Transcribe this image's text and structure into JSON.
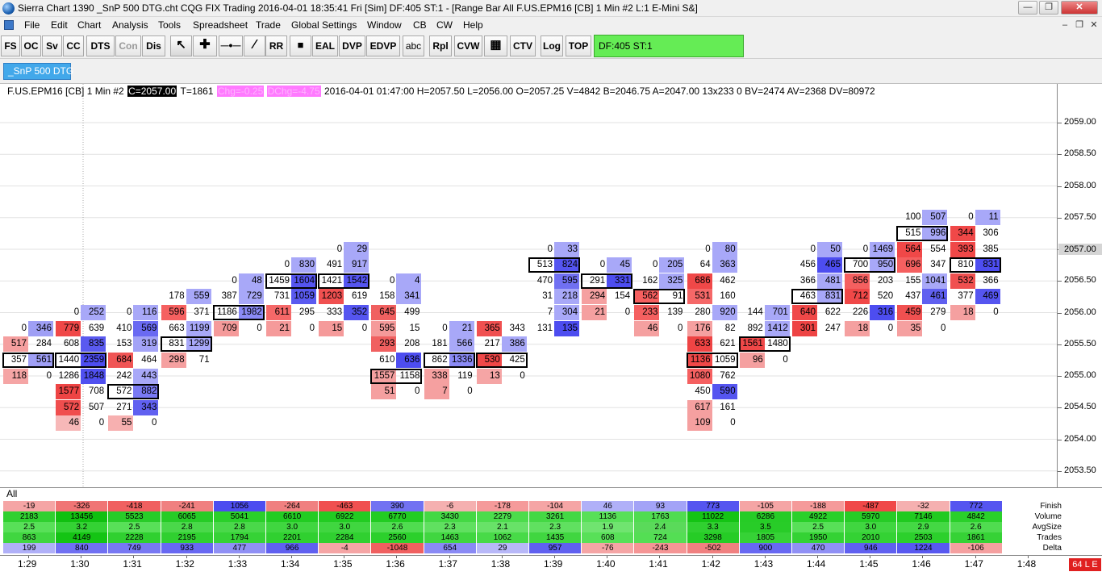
{
  "window": {
    "title": "Sierra Chart 1390 _SnP 500 DTG.cht  CQG FIX Trading 2016-04-01  18:35:41 Fri [Sim]  DF:405  ST:1 - [Range Bar All  F.US.EPM16 [CB]  1 Min  #2  L:1  E-Mini S&]"
  },
  "menu": [
    "File",
    "Edit",
    "Chart",
    "Analysis",
    "Tools",
    "Spreadsheet",
    "Trade",
    "Global Settings",
    "Window",
    "CB",
    "CW",
    "Help"
  ],
  "toolbar": [
    "FS",
    "OC",
    "Sv",
    "CC",
    "DTS",
    "Con",
    "Dis",
    "",
    "",
    "",
    "",
    "RR",
    "",
    "EAL",
    "DVP",
    "EDVP",
    "abc",
    "Rpl",
    "CVW",
    "",
    "CTV",
    "Log",
    "TOP"
  ],
  "toolbar_status": "DF:405  ST:1",
  "tab": "_SnP 500 DTG",
  "header": {
    "symbol": "F.US.EPM16 [CB]  1 Min  #2",
    "close": "C=2057.00",
    "trades": "T=1861",
    "chg": "Chg=-0.25",
    "dchg": "DChg=-4.75",
    "rest": "2016-04-01 01:47:00  H=2057.50  L=2056.00  O=2057.25  V=4842  B=2046.75  A=2047.00  13x233  0  BV=2474  AV=2368  DV=80972"
  },
  "price_axis": {
    "labels": [
      "2059.00",
      "2058.50",
      "2058.00",
      "2057.50",
      "2057.00",
      "2056.50",
      "2056.00",
      "2055.50",
      "2055.00",
      "2054.50",
      "2054.00",
      "2053.50"
    ],
    "current": "2057.00"
  },
  "time_axis": [
    "1:29",
    "1:30",
    "1:31",
    "1:32",
    "1:33",
    "1:34",
    "1:35",
    "1:36",
    "1:37",
    "1:38",
    "1:39",
    "1:40",
    "1:41",
    "1:42",
    "1:43",
    "1:44",
    "1:45",
    "1:46",
    "1:47",
    "1:48"
  ],
  "footprint": [
    {
      "bar": 0,
      "rows": [
        [
          "2055.75",
          "0",
          "346",
          "",
          "#9f9ff5"
        ],
        [
          "2055.50",
          "517",
          "284",
          "#f59f9f",
          ""
        ],
        [
          "2055.25",
          "357",
          "561",
          "",
          "#9f9ff5",
          true
        ],
        [
          "2055.00",
          "118",
          "0",
          "#f5a5a5",
          ""
        ]
      ]
    },
    {
      "bar": 1,
      "rows": [
        [
          "2056.00",
          "0",
          "252",
          "",
          "#a8a8f8"
        ],
        [
          "2055.75",
          "779",
          "639",
          "#f04848",
          ""
        ],
        [
          "2055.50",
          "608",
          "835",
          "",
          "#5a5af0"
        ],
        [
          "2055.25",
          "1440",
          "2359",
          "",
          "#4d4df0",
          true
        ],
        [
          "2055.00",
          "1286",
          "1848",
          "",
          "#5050f0"
        ],
        [
          "2054.75",
          "1577",
          "708",
          "#ee4444",
          ""
        ],
        [
          "2054.50",
          "572",
          "507",
          "#f04e4e",
          ""
        ],
        [
          "2054.25",
          "46",
          "0",
          "#f7b8b8",
          ""
        ]
      ]
    },
    {
      "bar": 2,
      "rows": [
        [
          "2056.00",
          "0",
          "116",
          "",
          "#a8a8f8"
        ],
        [
          "2055.75",
          "410",
          "569",
          "",
          "#6a6af2"
        ],
        [
          "2055.50",
          "153",
          "319",
          "",
          "#a3a3f7"
        ],
        [
          "2055.25",
          "684",
          "464",
          "#f05555",
          ""
        ],
        [
          "2055.00",
          "242",
          "443",
          "",
          "#a8a8f8"
        ],
        [
          "2054.75",
          "572",
          "882",
          "",
          "#7a7af3",
          true
        ],
        [
          "2054.50",
          "271",
          "343",
          "",
          "#6060f0"
        ],
        [
          "2054.25",
          "55",
          "0",
          "#f7b0b0",
          ""
        ]
      ]
    },
    {
      "bar": 3,
      "rows": [
        [
          "2056.25",
          "178",
          "559",
          "",
          "#a8a8f8"
        ],
        [
          "2056.00",
          "596",
          "371",
          "#f56060",
          ""
        ],
        [
          "2055.75",
          "663",
          "1199",
          "",
          "#a8a8f8"
        ],
        [
          "2055.50",
          "831",
          "1299",
          "",
          "#a8a8f8",
          true
        ],
        [
          "2055.25",
          "298",
          "71",
          "#f5a0a0",
          ""
        ]
      ]
    },
    {
      "bar": 4,
      "rows": [
        [
          "2056.50",
          "0",
          "48",
          "",
          "#a8a8f8"
        ],
        [
          "2056.25",
          "387",
          "729",
          "",
          "#a8a8f8"
        ],
        [
          "2056.00",
          "1186",
          "1982",
          "",
          "#8a8af5",
          true
        ],
        [
          "2055.75",
          "709",
          "0",
          "#f59a9a",
          ""
        ]
      ]
    },
    {
      "bar": 5,
      "rows": [
        [
          "2056.75",
          "0",
          "830",
          "",
          "#a8a8f8"
        ],
        [
          "2056.50",
          "1459",
          "1604",
          "",
          "#5555f0",
          true
        ],
        [
          "2056.25",
          "731",
          "1059",
          "",
          "#5a5af0"
        ],
        [
          "2056.00",
          "611",
          "295",
          "#f56868",
          ""
        ],
        [
          "2055.75",
          "21",
          "0",
          "#f59a9a",
          ""
        ]
      ]
    },
    {
      "bar": 6,
      "rows": [
        [
          "2057.00",
          "0",
          "29",
          "",
          "#a8a8f8"
        ],
        [
          "2056.75",
          "491",
          "917",
          "",
          "#a8a8f8"
        ],
        [
          "2056.50",
          "1421",
          "1542",
          "",
          "#5555f0",
          true
        ],
        [
          "2056.25",
          "1203",
          "619",
          "#f05050",
          ""
        ],
        [
          "2056.00",
          "333",
          "352",
          "",
          "#5555f0"
        ],
        [
          "2055.75",
          "15",
          "0",
          "#f59a9a",
          ""
        ]
      ]
    },
    {
      "bar": 7,
      "rows": [
        [
          "2056.50",
          "0",
          "4",
          "",
          "#a8a8f8"
        ],
        [
          "2056.25",
          "158",
          "341",
          "",
          "#a8a8f8"
        ],
        [
          "2056.00",
          "645",
          "499",
          "#f06060",
          ""
        ],
        [
          "2055.75",
          "595",
          "15",
          "#f59a9a",
          ""
        ],
        [
          "2055.50",
          "293",
          "208",
          "#f06060",
          ""
        ],
        [
          "2055.25",
          "610",
          "636",
          "",
          "#4d4df0"
        ],
        [
          "2055.00",
          "1557",
          "1158",
          "#f5a0a0",
          "",
          true
        ],
        [
          "2054.75",
          "51",
          "0",
          "#f5a0a0",
          ""
        ]
      ]
    },
    {
      "bar": 8,
      "rows": [
        [
          "2055.75",
          "0",
          "21",
          "",
          "#a8a8f8"
        ],
        [
          "2055.50",
          "181",
          "566",
          "",
          "#a8a8f8"
        ],
        [
          "2055.25",
          "862",
          "1336",
          "",
          "#8a8af5",
          true
        ],
        [
          "2055.00",
          "338",
          "119",
          "#f5a0a0",
          ""
        ],
        [
          "2054.75",
          "7",
          "0",
          "#f5a0a0",
          ""
        ]
      ]
    },
    {
      "bar": 9,
      "rows": [
        [
          "2055.75",
          "365",
          "343",
          "#f05050",
          ""
        ],
        [
          "2055.50",
          "217",
          "386",
          "",
          "#a8a8f8"
        ],
        [
          "2055.25",
          "530",
          "425",
          "#f04848",
          "",
          true
        ],
        [
          "2055.00",
          "13",
          "0",
          "#f5a5a5",
          ""
        ]
      ]
    },
    {
      "bar": 10,
      "rows": [
        [
          "2057.00",
          "0",
          "33",
          "",
          "#a8a8f8"
        ],
        [
          "2056.75",
          "513",
          "824",
          "",
          "#5555f0",
          true
        ],
        [
          "2056.50",
          "470",
          "595",
          "",
          "#7070f2"
        ],
        [
          "2056.25",
          "31",
          "218",
          "",
          "#a8a8f8"
        ],
        [
          "2056.00",
          "7",
          "304",
          "",
          "#a8a8f8"
        ],
        [
          "2055.75",
          "131",
          "135",
          "",
          "#4d4df0"
        ]
      ]
    },
    {
      "bar": 11,
      "rows": [
        [
          "2056.75",
          "0",
          "45",
          "",
          "#a8a8f8"
        ],
        [
          "2056.50",
          "291",
          "331",
          "",
          "#4d4df0",
          true
        ],
        [
          "2056.25",
          "294",
          "154",
          "#f5a0a0",
          ""
        ],
        [
          "2056.00",
          "21",
          "0",
          "#f5a0a0",
          ""
        ]
      ]
    },
    {
      "bar": 12,
      "rows": [
        [
          "2056.75",
          "0",
          "205",
          "",
          "#a8a8f8"
        ],
        [
          "2056.50",
          "162",
          "325",
          "",
          "#a8a8f8"
        ],
        [
          "2056.25",
          "562",
          "91",
          "#f56060",
          "",
          true
        ],
        [
          "2056.00",
          "233",
          "139",
          "#f56060",
          ""
        ],
        [
          "2055.75",
          "46",
          "0",
          "#f5a0a0",
          ""
        ]
      ]
    },
    {
      "bar": 13,
      "rows": [
        [
          "2057.00",
          "0",
          "80",
          "",
          "#a8a8f8"
        ],
        [
          "2056.75",
          "64",
          "363",
          "",
          "#a8a8f8"
        ],
        [
          "2056.50",
          "686",
          "462",
          "#f04848",
          ""
        ],
        [
          "2056.25",
          "531",
          "160",
          "#f56868",
          ""
        ],
        [
          "2056.00",
          "280",
          "920",
          "",
          "#a8a8f8"
        ],
        [
          "2055.75",
          "176",
          "82",
          "#f5a0a0",
          ""
        ],
        [
          "2055.50",
          "633",
          "621",
          "#ee4444",
          ""
        ],
        [
          "2055.25",
          "1136",
          "1059",
          "#f04848",
          "",
          true
        ],
        [
          "2055.00",
          "1080",
          "762",
          "#f56060",
          ""
        ],
        [
          "2054.75",
          "450",
          "590",
          "",
          "#5555f0"
        ],
        [
          "2054.50",
          "617",
          "161",
          "#f5a0a0",
          ""
        ],
        [
          "2054.25",
          "109",
          "0",
          "#f5a0a0",
          ""
        ]
      ]
    },
    {
      "bar": 14,
      "rows": [
        [
          "2056.00",
          "144",
          "701",
          "",
          "#a8a8f8"
        ],
        [
          "2055.75",
          "892",
          "1412",
          "",
          "#a8a8f8"
        ],
        [
          "2055.50",
          "1561",
          "1480",
          "#f04848",
          "",
          true
        ],
        [
          "2055.25",
          "96",
          "0",
          "#f5a0a0",
          ""
        ]
      ]
    },
    {
      "bar": 15,
      "rows": [
        [
          "2057.00",
          "0",
          "50",
          "",
          "#a8a8f8"
        ],
        [
          "2056.75",
          "456",
          "465",
          "",
          "#4d4df0"
        ],
        [
          "2056.50",
          "366",
          "481",
          "",
          "#a8a8f8"
        ],
        [
          "2056.25",
          "463",
          "831",
          "",
          "#a8a8f8",
          true
        ],
        [
          "2056.00",
          "640",
          "622",
          "#f04848",
          ""
        ],
        [
          "2055.75",
          "301",
          "247",
          "#ee4444",
          ""
        ]
      ]
    },
    {
      "bar": 16,
      "rows": [
        [
          "2057.00",
          "0",
          "1469",
          "",
          "#a8a8f8"
        ],
        [
          "2056.75",
          "700",
          "950",
          "",
          "#a8a8f8",
          true
        ],
        [
          "2056.50",
          "856",
          "203",
          "#f56060",
          ""
        ],
        [
          "2056.25",
          "712",
          "520",
          "#f04848",
          ""
        ],
        [
          "2056.00",
          "226",
          "316",
          "",
          "#4d4df0"
        ],
        [
          "2055.75",
          "18",
          "0",
          "#f5a0a0",
          ""
        ]
      ]
    },
    {
      "bar": 17,
      "rows": [
        [
          "2057.50",
          "100",
          "507",
          "",
          "#a8a8f8"
        ],
        [
          "2057.25",
          "515",
          "996",
          "",
          "#a8a8f8",
          true
        ],
        [
          "2057.00",
          "564",
          "554",
          "#f04848",
          ""
        ],
        [
          "2056.75",
          "696",
          "347",
          "#f56060",
          ""
        ],
        [
          "2056.50",
          "155",
          "1041",
          "",
          "#a8a8f8"
        ],
        [
          "2056.25",
          "437",
          "461",
          "",
          "#6060f0"
        ],
        [
          "2056.00",
          "459",
          "279",
          "#f05050",
          ""
        ],
        [
          "2055.75",
          "35",
          "0",
          "#f5a0a0",
          ""
        ]
      ]
    },
    {
      "bar": 18,
      "rows": [
        [
          "2057.50",
          "0",
          "11",
          "",
          "#a8a8f8"
        ],
        [
          "2057.25",
          "344",
          "306",
          "#f04848",
          ""
        ],
        [
          "2057.00",
          "393",
          "385",
          "#f04848",
          ""
        ],
        [
          "2056.75",
          "810",
          "831",
          "",
          "#4d4df0",
          true
        ],
        [
          "2056.50",
          "532",
          "366",
          "#f05050",
          ""
        ],
        [
          "2056.25",
          "377",
          "469",
          "",
          "#5555f0"
        ],
        [
          "2056.00",
          "18",
          "0",
          "#f5a0a0",
          ""
        ]
      ]
    }
  ],
  "subgraph": {
    "label": "All",
    "row_labels": [
      "Finish",
      "Volume",
      "AvgSize",
      "Trades",
      "Delta"
    ],
    "finish": [
      "-19",
      "-326",
      "-418",
      "-241",
      "1056",
      "-264",
      "-463",
      "390",
      "-6",
      "-178",
      "-104",
      "46",
      "93",
      "773",
      "-105",
      "-188",
      "-487",
      "-32",
      "772"
    ],
    "volume": [
      "2183",
      "13456",
      "5523",
      "6065",
      "5041",
      "6610",
      "6922",
      "6770",
      "3430",
      "2279",
      "3261",
      "1136",
      "1763",
      "11022",
      "6286",
      "4922",
      "5970",
      "7146",
      "4842"
    ],
    "avgsize": [
      "2.5",
      "3.2",
      "2.5",
      "2.8",
      "2.8",
      "3.0",
      "3.0",
      "2.6",
      "2.3",
      "2.1",
      "2.3",
      "1.9",
      "2.4",
      "3.3",
      "3.5",
      "2.5",
      "3.0",
      "2.9",
      "2.6"
    ],
    "trades": [
      "863",
      "4149",
      "2228",
      "2195",
      "1794",
      "2201",
      "2284",
      "2560",
      "1463",
      "1062",
      "1435",
      "608",
      "724",
      "3298",
      "1805",
      "1950",
      "2010",
      "2503",
      "1861"
    ],
    "delta": [
      "199",
      "840",
      "749",
      "933",
      "477",
      "966",
      "-4",
      "-1048",
      "654",
      "29",
      "957",
      "-76",
      "-243",
      "-502",
      "900",
      "470",
      "946",
      "1224",
      "-106"
    ],
    "finish_colors": [
      "#f5a5a5",
      "#f07575",
      "#f06060",
      "#f08080",
      "#4d4df0",
      "#f08080",
      "#f05050",
      "#7272f2",
      "#f5b0b0",
      "#f59a9a",
      "#f5a5a5",
      "#b0b0f8",
      "#a3a3f7",
      "#5555f0",
      "#f5a5a5",
      "#f59a9a",
      "#f04848",
      "#f5b0b0",
      "#5555f0"
    ],
    "volume_colors": [
      "#30d030",
      "#10c010",
      "#28cc28",
      "#26cc26",
      "#2ad02a",
      "#22cc22",
      "#22cc22",
      "#22cc22",
      "#44d844",
      "#4cdc4c",
      "#44d844",
      "#58e058",
      "#50dc50",
      "#14c414",
      "#26cc26",
      "#2ad02a",
      "#26cc26",
      "#20ca20",
      "#2ad02a"
    ],
    "avgsize_colors": [
      "#58e058",
      "#34d234",
      "#58e058",
      "#4ad84a",
      "#4ad84a",
      "#40d640",
      "#40d640",
      "#50dc50",
      "#60e060",
      "#68e268",
      "#60e060",
      "#70e470",
      "#5ada5a",
      "#30d030",
      "#28cc28",
      "#58e058",
      "#40d640",
      "#44d844",
      "#50dc50"
    ],
    "trades_colors": [
      "#40d640",
      "#14c414",
      "#30d030",
      "#30d030",
      "#36d236",
      "#30d030",
      "#30d030",
      "#2cd02c",
      "#40d640",
      "#48da48",
      "#40d640",
      "#58e058",
      "#54de54",
      "#26cc26",
      "#36d236",
      "#34d234",
      "#34d234",
      "#2cd02c",
      "#36d236"
    ],
    "delta_colors": [
      "#b0b0f8",
      "#7070f2",
      "#7878f3",
      "#6868f2",
      "#9090f5",
      "#6060f0",
      "#f5a5a5",
      "#f06060",
      "#8a8af5",
      "#b8b8f8",
      "#6060f0",
      "#f5a5a5",
      "#f59595",
      "#f08080",
      "#6868f2",
      "#9090f5",
      "#6060f0",
      "#5858f0",
      "#f5a0a0"
    ]
  },
  "corner_badge": "64 L E"
}
